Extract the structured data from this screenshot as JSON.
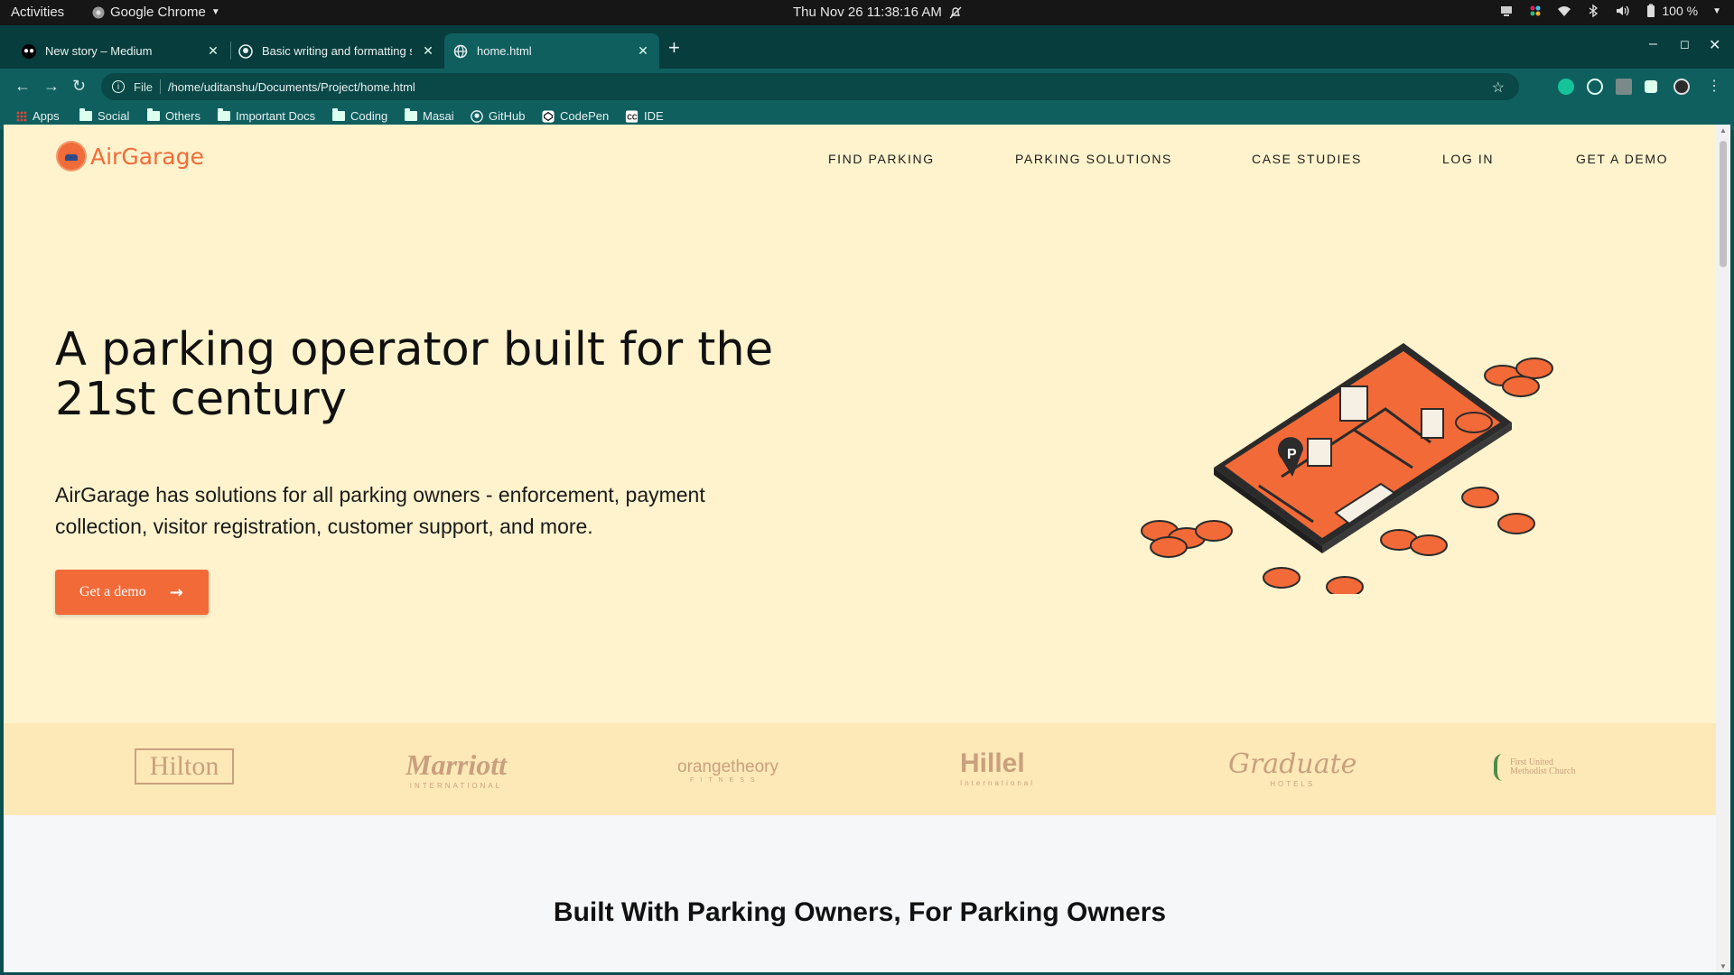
{
  "system_bar": {
    "activities": "Activities",
    "app_name": "Google Chrome",
    "clock": "Thu Nov 26  11:38:16 AM",
    "battery": "100 %"
  },
  "browser": {
    "tabs": [
      {
        "title": "New story – Medium",
        "icon": "medium-icon"
      },
      {
        "title": "Basic writing and formatting sy",
        "icon": "github-icon"
      },
      {
        "title": "home.html",
        "icon": "globe-icon"
      }
    ],
    "address": {
      "scheme": "File",
      "url": "/home/uditanshu/Documents/Project/home.html"
    },
    "bookmarks": [
      "Apps",
      "Social",
      "Others",
      "Important Docs",
      "Coding",
      "Masai",
      "GitHub",
      "CodePen",
      "IDE"
    ]
  },
  "site": {
    "brand": "AirGarage",
    "nav": [
      "FIND PARKING",
      "PARKING SOLUTIONS",
      "CASE STUDIES",
      "LOG IN",
      "GET A DEMO"
    ],
    "hero": {
      "title": "A parking operator built for the 21st century",
      "subtitle": "AirGarage has solutions for all parking owners - enforcement, payment collection, visitor registration, customer support, and more.",
      "cta": "Get a demo"
    },
    "partner_logos": {
      "hilton": "Hilton",
      "marriott": "Marriott",
      "marriott_sub": "INTERNATIONAL",
      "orangetheory": "orangetheory",
      "orangetheory_sub": "FITNESS",
      "hillel": "Hillel",
      "hillel_sub": "International",
      "graduate": "Graduate",
      "graduate_sub": "HOTELS",
      "church_line1": "First United",
      "church_line2": "Methodist Church"
    },
    "section_title": "Built With Parking Owners, For Parking Owners"
  },
  "colors": {
    "accent": "#f26a38",
    "hero_bg": "#fff3cd",
    "logos_bg": "#fde9b8",
    "chrome_theme": "#0f5f5f"
  }
}
